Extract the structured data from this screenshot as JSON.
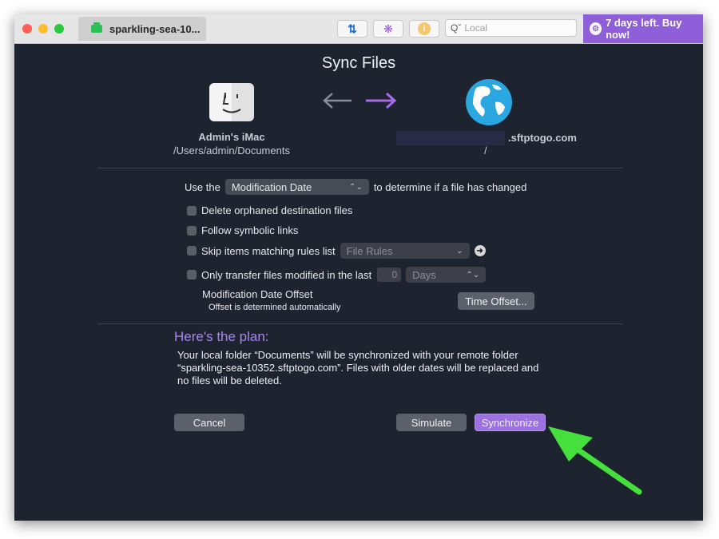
{
  "titlebar": {
    "tab_label": "sparkling-sea-10...",
    "search_placeholder": "Local",
    "buy_label": "7 days left. Buy now!"
  },
  "dialog": {
    "title": "Sync Files",
    "local": {
      "name": "Admin's iMac",
      "path": "/Users/admin/Documents"
    },
    "remote": {
      "name": ".sftptogo.com",
      "path": "/"
    },
    "compare": {
      "prefix": "Use the",
      "selected": "Modification Date",
      "suffix": "to determine if a file has changed"
    },
    "options": {
      "delete_orphaned": {
        "label": "Delete orphaned destination files",
        "checked": false
      },
      "follow_symlinks": {
        "label": "Follow symbolic links",
        "checked": false
      },
      "skip_items": {
        "label": "Skip items matching rules list",
        "checked": false,
        "rules_value": "File Rules"
      },
      "only_transfer": {
        "label": "Only transfer files modified in the last",
        "checked": false,
        "amount": "0",
        "unit": "Days"
      }
    },
    "offset": {
      "title": "Modification Date Offset",
      "subtitle": "Offset is determined automatically",
      "button": "Time Offset..."
    },
    "plan": {
      "heading": "Here's the plan:",
      "text": "Your local folder “Documents” will be synchronized with your remote folder “sparkling-sea-10352.sftptogo.com”. Files with older dates will be replaced and no files will be deleted."
    },
    "buttons": {
      "cancel": "Cancel",
      "simulate": "Simulate",
      "synchronize": "Synchronize"
    }
  },
  "colors": {
    "background": "#1e2330",
    "accent": "#9b72e0",
    "buy_banner": "#8f5fd9",
    "annotation_arrow": "#46e03c"
  },
  "icons": [
    "finder-icon",
    "arrow-left-icon",
    "arrow-right-icon",
    "globe-icon",
    "sync-icon",
    "activity-icon",
    "info-icon",
    "search-icon",
    "gear-icon",
    "chevron-icon",
    "go-arrow-icon"
  ]
}
